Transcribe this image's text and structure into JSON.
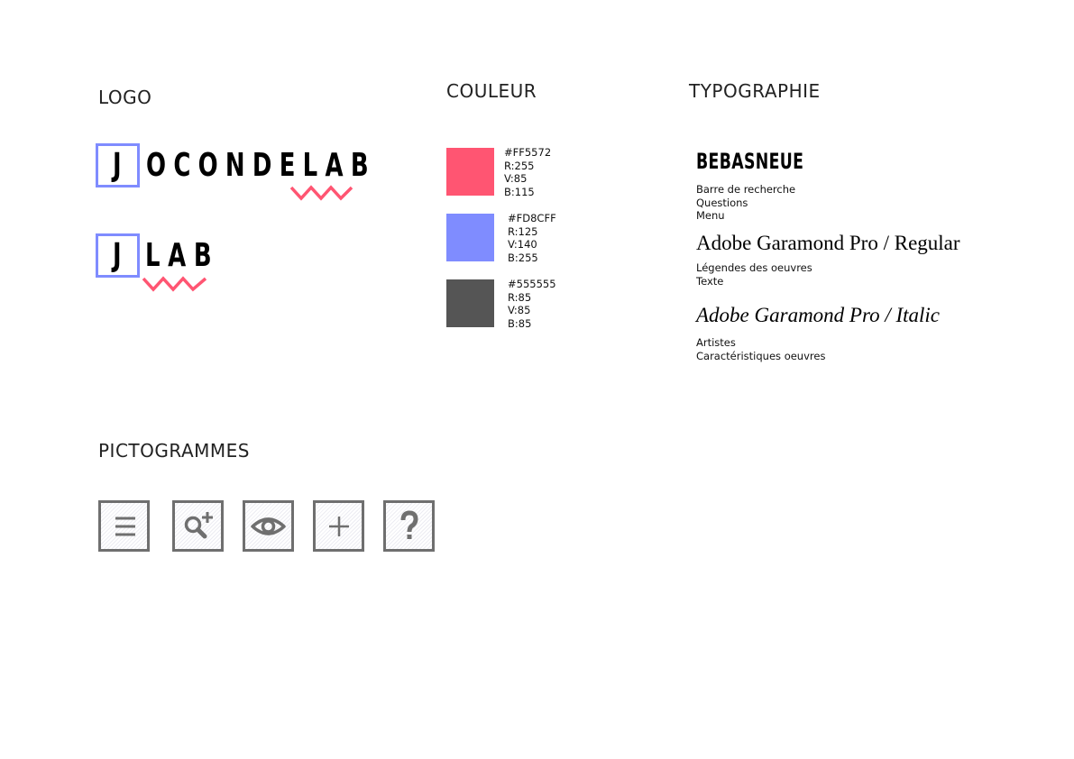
{
  "sections": {
    "logo": "LOGO",
    "couleur": "COULEUR",
    "typographie": "TYPOGRAPHIE",
    "pictogrammes": "PICTOGRAMMES"
  },
  "logo": {
    "main_initial": "J",
    "main_rest": "OCONDELAB",
    "short_initial": "J",
    "short_rest": "LAB",
    "box_color": "#7f8cff",
    "wave_color": "#ff5572"
  },
  "colors": [
    {
      "hex": "#FF5572",
      "r": "R:255",
      "v": "V:85",
      "b": "B:115",
      "swatch": "#ff5572"
    },
    {
      "hex": "#FD8CFF",
      "r": "R:125",
      "v": "V:140",
      "b": "B:255",
      "swatch": "#7f8cff"
    },
    {
      "hex": "#555555",
      "r": "R:85",
      "v": "V:85",
      "b": "B:85",
      "swatch": "#555555"
    }
  ],
  "typography": [
    {
      "name": "BEBASNEUE",
      "uses": [
        "Barre de recherche",
        "Questions",
        "Menu"
      ]
    },
    {
      "name": "Adobe Garamond Pro / Regular",
      "uses": [
        "Légendes des oeuvres",
        "Texte"
      ]
    },
    {
      "name": "Adobe Garamond Pro / Italic",
      "uses": [
        "Artistes",
        "Caractéristiques oeuvres"
      ]
    }
  ],
  "pictograms": [
    "menu-icon",
    "zoom-plus-icon",
    "eye-icon",
    "plus-icon",
    "question-icon"
  ],
  "icon_color": "#6f6f6f"
}
